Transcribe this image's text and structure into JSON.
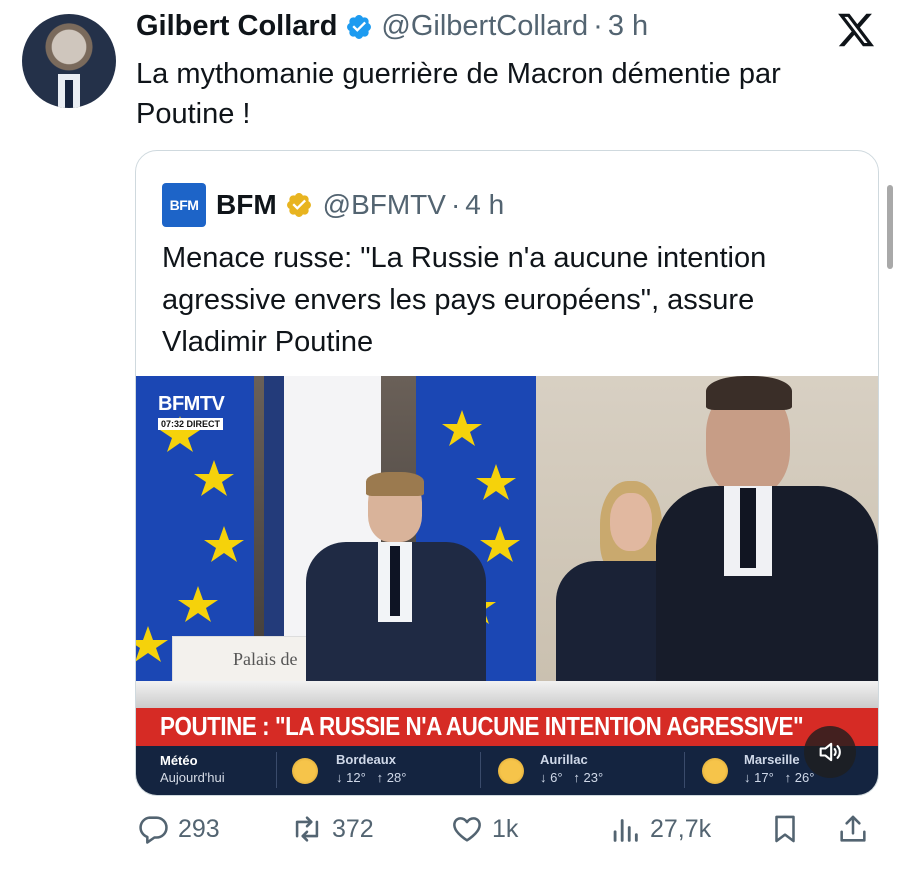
{
  "tweet": {
    "author_name": "Gilbert Collard",
    "handle": "@GilbertCollard",
    "separator": "·",
    "time": "3 h",
    "text": "La mythomanie guerrière de Macron démentie par Poutine !",
    "verified_color": "#1d9bf0",
    "avatar_icon": "profile-photo"
  },
  "platform_logo": "x-logo",
  "quoted_tweet": {
    "logo_text": "BFM",
    "author_name": "BFM",
    "handle": "@BFMTV",
    "separator": "·",
    "time": "4 h",
    "text": "Menace russe: \"La Russie n'a aucune intention agressive envers les pays européens\", assure Vladimir Poutine",
    "verified_color": "#e8b420",
    "media": {
      "channel_bug": "BFMTV",
      "channel_time": "07:32 DIRECT",
      "sign_text": "Palais de",
      "banner": "POUTINE : \"LA RUSSIE N'A AUCUNE INTENTION AGRESSIVE\"",
      "weather": {
        "label": "Météo",
        "sublabel": "Aujourd'hui",
        "cities": [
          {
            "name": "Bordeaux",
            "low": "↓ 12°",
            "high": "↑ 28°"
          },
          {
            "name": "Aurillac",
            "low": "↓ 6°",
            "high": "↑ 23°"
          },
          {
            "name": "Marseille",
            "low": "↓ 17°",
            "high": "↑ 26°"
          }
        ]
      }
    }
  },
  "actions": {
    "replies": "293",
    "reposts": "372",
    "likes": "1k",
    "views": "27,7k"
  },
  "colors": {
    "text": "#0f1419",
    "secondary": "#536471",
    "bfm_blue": "#1d64c8",
    "banner_red": "#d62b25",
    "weather_navy": "#142440"
  }
}
